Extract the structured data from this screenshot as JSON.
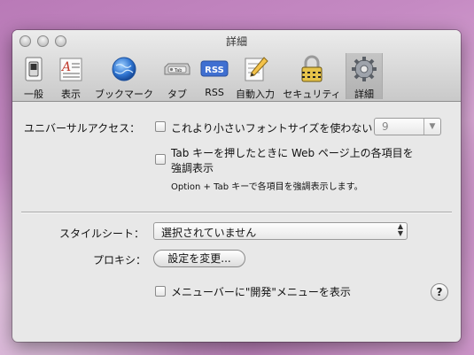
{
  "window": {
    "title": "詳細"
  },
  "toolbar": {
    "items": [
      {
        "label": "一般",
        "icon": "general-switch-icon"
      },
      {
        "label": "表示",
        "icon": "font-display-icon"
      },
      {
        "label": "ブックマーク",
        "icon": "globe-icon"
      },
      {
        "label": "タブ",
        "icon": "tab-icon"
      },
      {
        "label": "RSS",
        "icon": "rss-icon",
        "icon_text": "RSS"
      },
      {
        "label": "自動入力",
        "icon": "pencil-form-icon"
      },
      {
        "label": "セキュリティ",
        "icon": "padlock-icon"
      },
      {
        "label": "詳細",
        "icon": "gear-icon",
        "selected": true
      }
    ]
  },
  "accessibility": {
    "label": "ユニバーサルアクセス：",
    "min_font": {
      "label": "これより小さいフォントサイズを使わない：",
      "checked": false,
      "value": "9"
    },
    "tab_highlight": {
      "label_line1": "Tab キーを押したときに Web ページ上の各項目を",
      "label_line2": "強調表示",
      "checked": false,
      "hint": "Option + Tab キーで各項目を強調表示します。"
    }
  },
  "stylesheet": {
    "label": "スタイルシート：",
    "value": "選択されていません"
  },
  "proxy": {
    "label": "プロキシ：",
    "button": "設定を変更..."
  },
  "develop_menu": {
    "label": "メニューバーに\"開発\"メニューを表示",
    "checked": false
  },
  "help": {
    "label": "?"
  },
  "colors": {
    "window_bg": "#e8e8e8",
    "rss_blue": "#3f6fd1"
  }
}
